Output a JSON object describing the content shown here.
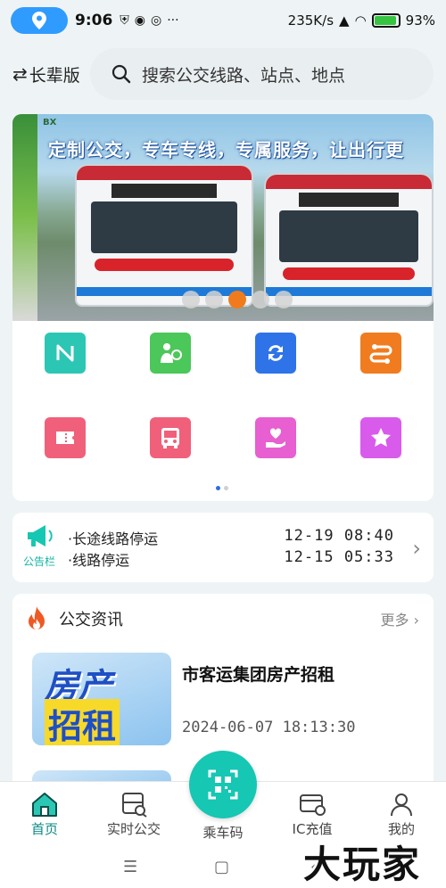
{
  "status_bar": {
    "time": "9:06",
    "speed": "235K/s",
    "battery": "93%",
    "battery_fraction": 0.93
  },
  "header": {
    "version_label": "长辈版",
    "search_placeholder": "搜索公交线路、站点、地点"
  },
  "banner": {
    "caption": "定制公交，专车专线，专属服务，让出行更",
    "logo_text": "BX",
    "slide_count": 5,
    "active_slide": 2
  },
  "quick_grid": {
    "items": [
      {
        "icon": "nfc-icon",
        "color": "#2cc7b4"
      },
      {
        "icon": "elder-card-icon",
        "color": "#4cc75a"
      },
      {
        "icon": "refresh-icon",
        "color": "#2f73e8"
      },
      {
        "icon": "route-icon",
        "color": "#f07c1f"
      },
      {
        "icon": "ticket-icon",
        "color": "#f0607a"
      },
      {
        "icon": "bus-icon",
        "color": "#f0607a"
      },
      {
        "icon": "heart-hand-icon",
        "color": "#e75fd0"
      },
      {
        "icon": "star-icon",
        "color": "#d95bec"
      }
    ],
    "page_count": 2,
    "active_page": 0
  },
  "notice": {
    "label": "公告栏",
    "items": [
      {
        "title": "·长途线路停运",
        "time": "12-19 08:40"
      },
      {
        "title": "·线路停运",
        "time": "12-15 05:33"
      }
    ]
  },
  "news": {
    "section_title": "公交资讯",
    "more_label": "更多",
    "thumb_text_1": "房产",
    "thumb_text_2": "招租",
    "headline": "市客运集团房产招租",
    "date": "2024-06-07 18:13:30"
  },
  "tabbar": {
    "home": "首页",
    "realtime": "实时公交",
    "ride_code": "乘车码",
    "ic_recharge": "IC充值",
    "mine": "我的"
  },
  "watermark": "大玩家",
  "colors": {
    "accent": "#16c7b3",
    "active_tab": "#0a8a84",
    "slide_active": "#f07b1d"
  }
}
